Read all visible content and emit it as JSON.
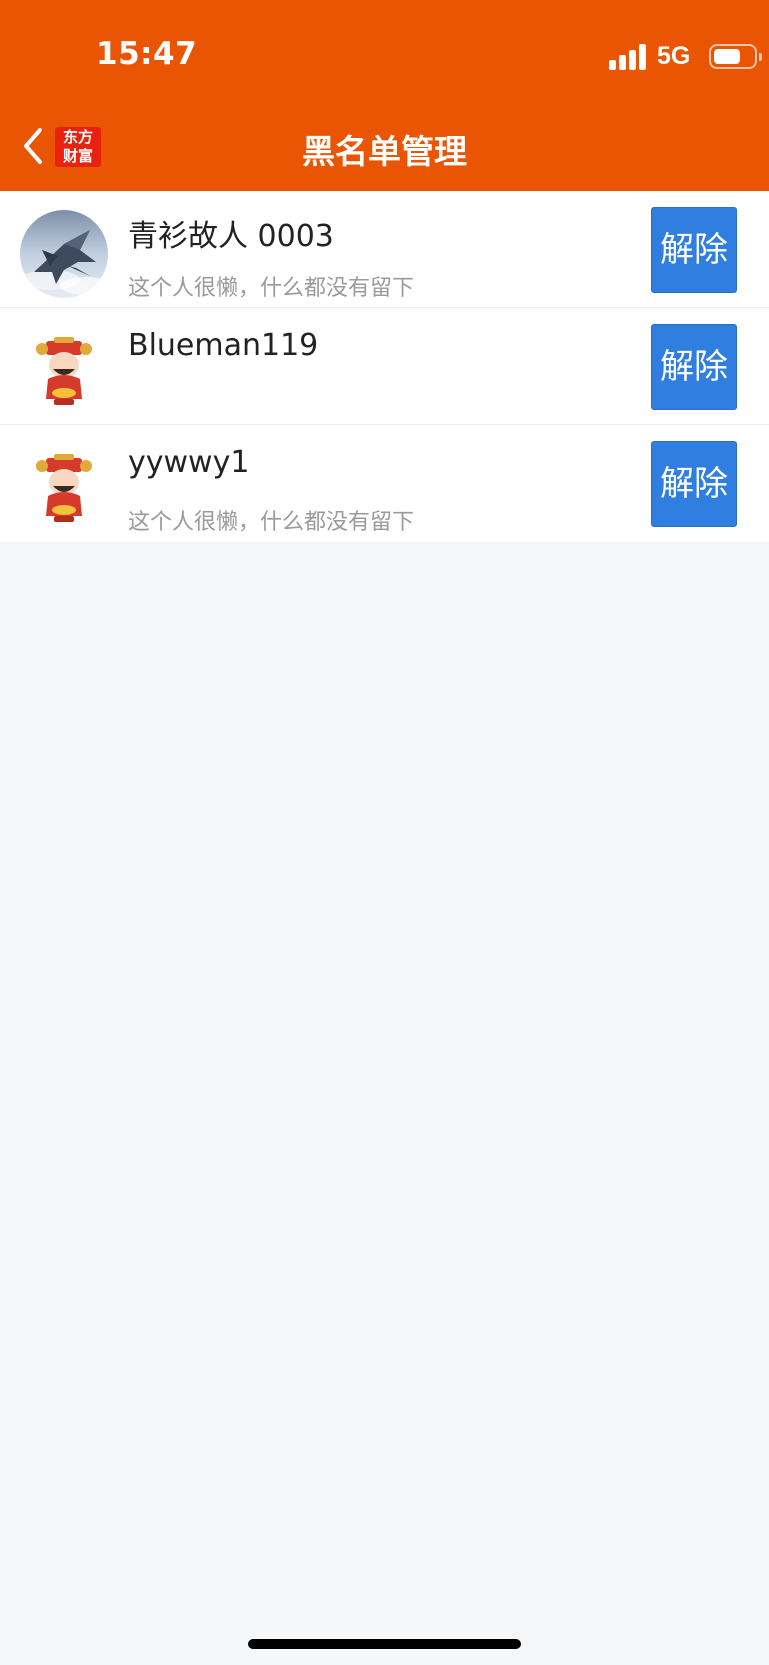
{
  "status_bar": {
    "time": "15:47",
    "network": "5G",
    "icons": [
      "signal-icon",
      "battery-icon"
    ]
  },
  "nav": {
    "title": "黑名单管理",
    "back_icon": "chevron-left-icon",
    "logo_line1": "东方",
    "logo_line2": "财富"
  },
  "colors": {
    "header_bg": "#ea5504",
    "button_bg": "#2f7ee0",
    "page_bg": "#f5f6f8"
  },
  "blacklist": [
    {
      "name": "青衫故人 0003",
      "bio": "这个人很懒，什么都没有留下",
      "avatar": "fighter-jet-avatar",
      "action": "解除"
    },
    {
      "name": "Blueman119",
      "bio": "",
      "avatar": "fortune-god-avatar",
      "action": "解除"
    },
    {
      "name": "yywwy1",
      "bio": "这个人很懒，什么都没有留下",
      "avatar": "fortune-god-avatar",
      "action": "解除"
    }
  ]
}
